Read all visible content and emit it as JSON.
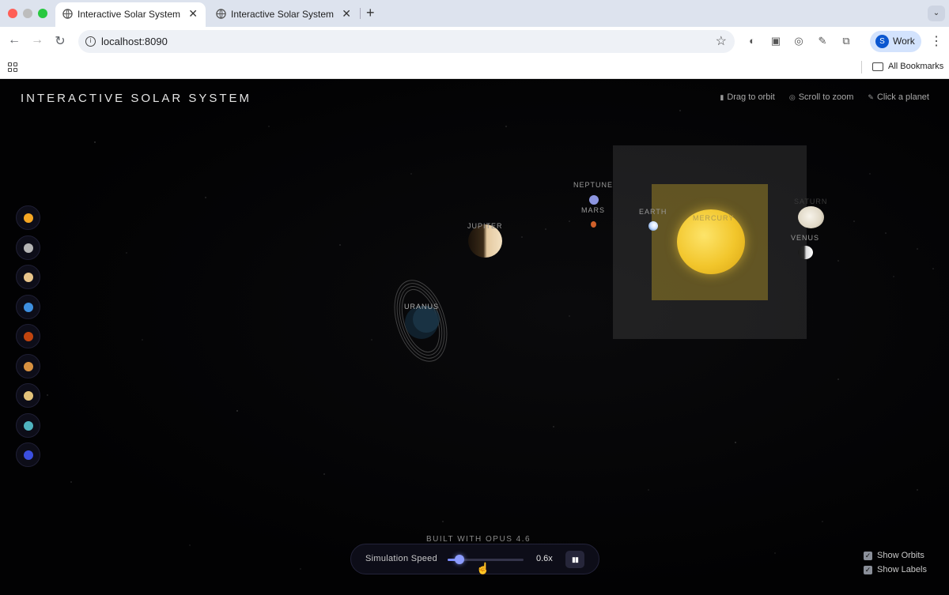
{
  "browser": {
    "tabs": [
      {
        "title": "Interactive Solar System",
        "active": true
      },
      {
        "title": "Interactive Solar System",
        "active": false
      }
    ],
    "url": "localhost:8090",
    "profile_initial": "S",
    "profile_name": "Work",
    "bookmarks_label": "All Bookmarks"
  },
  "app": {
    "title": "INTERACTIVE SOLAR SYSTEM",
    "hints": [
      {
        "icon": "hand-icon",
        "text": "Drag to orbit"
      },
      {
        "icon": "scroll-icon",
        "text": "Scroll to zoom"
      },
      {
        "icon": "pointer-icon",
        "text": "Click a planet"
      }
    ],
    "planet_buttons": [
      {
        "name": "sun",
        "color": "#f5a623"
      },
      {
        "name": "mercury",
        "color": "#b5b5b5"
      },
      {
        "name": "venus",
        "color": "#e8c48a"
      },
      {
        "name": "earth",
        "color": "#3d8fe0"
      },
      {
        "name": "mars",
        "color": "#c1440e"
      },
      {
        "name": "jupiter",
        "color": "#d89140"
      },
      {
        "name": "saturn",
        "color": "#e3c27a"
      },
      {
        "name": "uranus",
        "color": "#4fb3bf"
      },
      {
        "name": "neptune",
        "color": "#3b4fe0"
      }
    ],
    "labels": {
      "neptune": "NEPTUNE",
      "mars": "MARS",
      "jupiter": "JUPITER",
      "earth": "EARTH",
      "mercury": "MERCURY",
      "saturn": "SATURN",
      "venus": "VENUS",
      "uranus": "URANUS"
    },
    "footer_credit": "BUILT WITH OPUS 4.6",
    "speed": {
      "label": "Simulation Speed",
      "value": 0.6,
      "value_text": "0.6x",
      "fraction": 0.18
    },
    "toggles": [
      {
        "label": "Show Orbits",
        "checked": true
      },
      {
        "label": "Show Labels",
        "checked": true
      }
    ]
  }
}
